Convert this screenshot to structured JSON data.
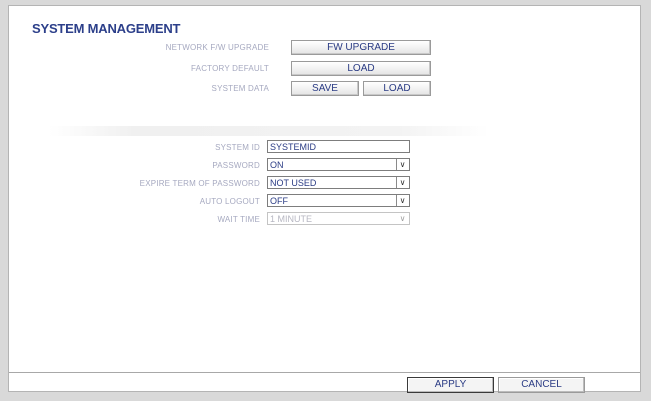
{
  "page": {
    "title": "SYSTEM MANAGEMENT"
  },
  "upgrade": {
    "network_label": "NETWORK F/W UPGRADE",
    "fw_upgrade_button": "FW UPGRADE",
    "factory_label": "FACTORY DEFAULT",
    "load_button": "LOAD",
    "system_data_label": "SYSTEM DATA",
    "save_button": "SAVE",
    "system_data_load_button": "LOAD"
  },
  "settings": {
    "system_id": {
      "label": "SYSTEM ID",
      "value": "SYSTEMID"
    },
    "password": {
      "label": "PASSWORD",
      "value": "ON"
    },
    "expire": {
      "label": "EXPIRE TERM OF PASSWORD",
      "value": "NOT USED"
    },
    "auto_logout": {
      "label": "AUTO LOGOUT",
      "value": "OFF"
    },
    "wait_time": {
      "label": "WAIT TIME",
      "value": "1 MINUTE",
      "disabled": true
    }
  },
  "footer": {
    "apply_button": "APPLY",
    "cancel_button": "CANCEL"
  },
  "icons": {
    "dropdown": "chevron-down-icon"
  },
  "colors": {
    "text_blue": "#2a3b84",
    "label_gray": "#a6a9c0",
    "title_blue": "#2c3f8a"
  }
}
